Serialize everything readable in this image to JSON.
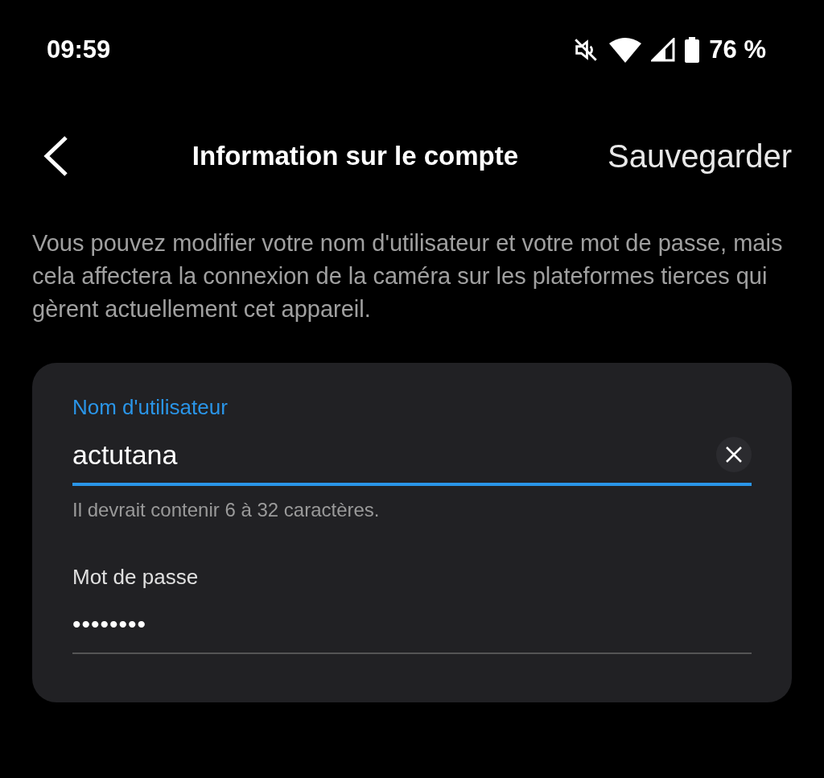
{
  "status_bar": {
    "time": "09:59",
    "battery": "76 %"
  },
  "header": {
    "title": "Information sur le compte",
    "action": "Sauvegarder"
  },
  "description": "Vous pouvez modifier votre nom d'utilisateur et votre mot de passe, mais cela affectera la connexion de la caméra sur les plateformes tierces qui gèrent actuellement cet appareil.",
  "fields": [
    {
      "kind": "text",
      "label": "Nom d'utilisateur",
      "value": "actutana",
      "helper": "Il devrait contenir 6 à 32 caractères.",
      "focused": true
    },
    {
      "kind": "password",
      "label": "Mot de passe",
      "value": "••••••••",
      "focused": false
    }
  ]
}
